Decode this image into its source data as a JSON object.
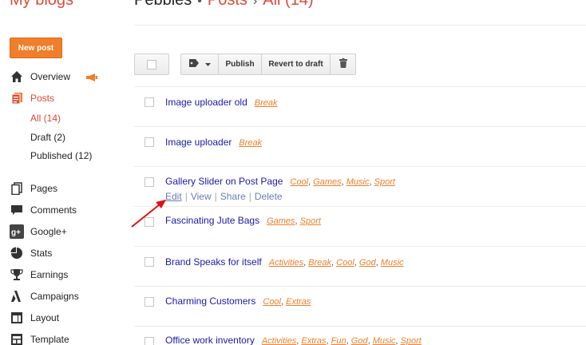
{
  "header": {
    "app_title": "My blogs",
    "blog_name": "Pebbles",
    "separator": "›",
    "section": "Posts",
    "filter": "All (14)"
  },
  "sidebar": {
    "new_post_label": "New post",
    "items": [
      {
        "label": "Overview",
        "icon": "home-icon"
      },
      {
        "label": "Posts",
        "icon": "posts-icon"
      },
      {
        "label": "Pages",
        "icon": "pages-icon"
      },
      {
        "label": "Comments",
        "icon": "comments-icon"
      },
      {
        "label": "Google+",
        "icon": "google-plus-icon"
      },
      {
        "label": "Stats",
        "icon": "stats-icon"
      },
      {
        "label": "Earnings",
        "icon": "trophy-icon"
      },
      {
        "label": "Campaigns",
        "icon": "campaigns-icon"
      },
      {
        "label": "Layout",
        "icon": "layout-icon"
      },
      {
        "label": "Template",
        "icon": "template-icon"
      }
    ],
    "sub_items": [
      {
        "label": "All (14)"
      },
      {
        "label": "Draft (2)"
      },
      {
        "label": "Published (12)"
      }
    ]
  },
  "toolbar": {
    "publish_label": "Publish",
    "revert_label": "Revert to draft"
  },
  "posts": [
    {
      "title": "Image uploader old",
      "labels": [
        "Break"
      ]
    },
    {
      "title": "Image uploader",
      "labels": [
        "Break"
      ]
    },
    {
      "title": "Gallery Slider on Post Page",
      "labels": [
        "Cool",
        "Games",
        "Music",
        "Sport"
      ]
    },
    {
      "title": "Fascinating Jute Bags",
      "labels": [
        "Games",
        "Sport"
      ]
    },
    {
      "title": "Brand Speaks for itself",
      "labels": [
        "Activities",
        "Break",
        "Cool",
        "God",
        "Music"
      ]
    },
    {
      "title": "Charming Customers",
      "labels": [
        "Cool",
        "Extras"
      ]
    },
    {
      "title": "Office work inventory",
      "labels": [
        "Activities",
        "Extras",
        "Fun",
        "God",
        "Music",
        "Sport"
      ]
    }
  ],
  "row_actions": {
    "edit": "Edit",
    "view": "View",
    "share": "Share",
    "delete": "Delete",
    "separator": "|"
  },
  "colors": {
    "accent": "#dd4b39",
    "button_orange": "#f07e2a",
    "link_blue": "#1a1aa8",
    "label_orange": "#f07e2a",
    "arrow_red": "#e01010"
  }
}
